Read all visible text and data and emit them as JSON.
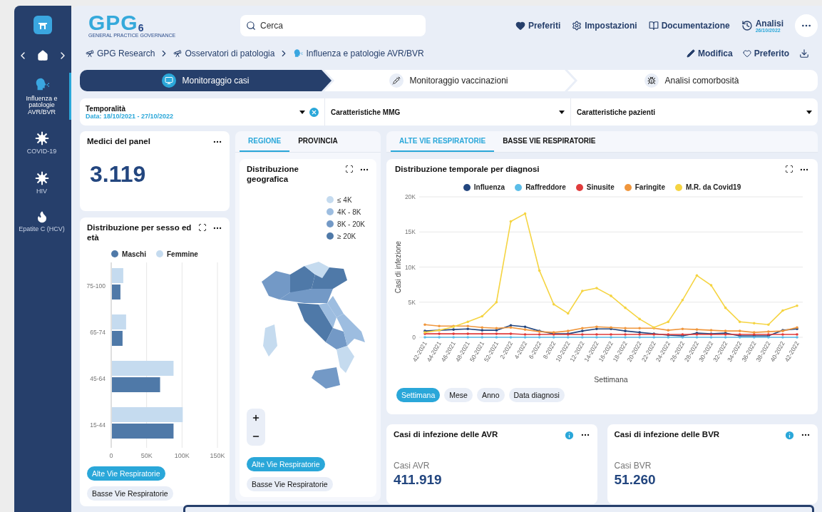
{
  "logo": {
    "text": "GPG",
    "subtitle": "GENERAL PRACTICE GOVERNANCE",
    "badge": "6"
  },
  "sidebar": {
    "items": [
      {
        "label": "Influenza e patologie AVR/BVR",
        "kind": "head",
        "selected": true
      },
      {
        "label": "COVID-19",
        "kind": "virus",
        "selected": false
      },
      {
        "label": "HIV",
        "kind": "virus",
        "selected": false
      },
      {
        "label": "Epatite C (HCV)",
        "kind": "flame",
        "selected": false
      }
    ]
  },
  "header": {
    "search": {
      "placeholder": "Cerca"
    },
    "links": [
      {
        "label": "Preferiti",
        "kind": "heart"
      },
      {
        "label": "Impostazioni",
        "kind": "gear"
      },
      {
        "label": "Documentazione",
        "kind": "book"
      }
    ],
    "analysis": {
      "label": "Analisi",
      "date": "26/10/2022"
    }
  },
  "breadcrumb": [
    {
      "label": "GPG Research",
      "kind": "telescope"
    },
    {
      "label": "Osservatori di patologia",
      "kind": "telescope"
    },
    {
      "label": "Influenza e patologie AVR/BVR",
      "kind": "head"
    }
  ],
  "actions": [
    {
      "label": "Modifica",
      "kind": "pencil"
    },
    {
      "label": "Preferito",
      "kind": "heart"
    },
    {
      "kind": "download"
    }
  ],
  "steps": [
    {
      "label": "Monitoraggio casi",
      "kind": "monitor",
      "selected": true
    },
    {
      "label": "Monitoraggio vaccinazioni",
      "kind": "syringe",
      "selected": false
    },
    {
      "label": "Analisi comorbosità",
      "kind": "bug",
      "selected": false
    }
  ],
  "filters": [
    {
      "label": "Temporalità",
      "value": "Data: 18/10/2021 - 27/10/2022",
      "clearable": true
    },
    {
      "label": "Caratteristiche MMG",
      "clearable": false
    },
    {
      "label": "Caratteristiche pazienti",
      "clearable": false
    }
  ],
  "panel_card": {
    "title": "Medici del panel",
    "value": "3.119"
  },
  "age_sex": {
    "title": "Distribuzione per sesso ed età",
    "chart_data": {
      "type": "bar",
      "orientation": "horizontal",
      "categories": [
        "75-100",
        "65-74",
        "45-64",
        "15-44"
      ],
      "series": [
        {
          "name": "Maschi",
          "color": "#4f79a8",
          "values": [
            12000,
            15000,
            68000,
            87000
          ]
        },
        {
          "name": "Femmine",
          "color": "#c5dbef",
          "values": [
            16000,
            20000,
            87000,
            100000
          ]
        }
      ],
      "xlim": [
        0,
        150000
      ],
      "grid": true,
      "xticks": [
        {
          "value": 0,
          "label": "0"
        },
        {
          "value": 50000,
          "label": "50K"
        },
        {
          "value": 100000,
          "label": "100K"
        },
        {
          "value": 150000,
          "label": "150K"
        }
      ]
    },
    "filters": [
      {
        "label": "Alte Vie Respiratorie",
        "selected": true
      },
      {
        "label": "Basse Vie Respiratorie",
        "selected": false
      }
    ]
  },
  "geo": {
    "tabs": [
      {
        "label": "REGIONE",
        "selected": true
      },
      {
        "label": "PROVINCIA",
        "selected": false
      }
    ],
    "title": "Distribuzione geografica",
    "legend": [
      {
        "label": "≤ 4K",
        "color": "#c5dbef"
      },
      {
        "label": "4K - 8K",
        "color": "#9dbde0"
      },
      {
        "label": "8K - 20K",
        "color": "#7399c6"
      },
      {
        "label": "≥ 20K",
        "color": "#4f79a8"
      }
    ],
    "filters": [
      {
        "label": "Alte Vie Respiratorie",
        "selected": true
      },
      {
        "label": "Basse Vie Respiratorie",
        "selected": false
      }
    ]
  },
  "diagnosis": {
    "tabs": [
      {
        "label": "ALTE VIE RESPIRATORIE",
        "selected": true
      },
      {
        "label": "BASSE VIE RESPIRATORIE",
        "selected": false
      }
    ],
    "title": "Distribuzione temporale per diagnosi",
    "chart_data": {
      "type": "line",
      "xlabel": "Settimana",
      "ylabel": "Casi di infezione",
      "categories": [
        "42-2021",
        "44-2021",
        "46-2021",
        "48-2021",
        "50-2021",
        "52-2021",
        "2-2022",
        "4-2022",
        "6-2022",
        "8-2022",
        "10-2022",
        "12-2022",
        "14-2022",
        "16-2022",
        "18-2022",
        "20-2022",
        "22-2022",
        "24-2022",
        "26-2022",
        "28-2022",
        "30-2022",
        "32-2022",
        "34-2022",
        "36-2022",
        "38-2022",
        "40-2022",
        "42-2022"
      ],
      "series": [
        {
          "name": "Influenza",
          "color": "#23467f",
          "values": [
            900,
            1000,
            1100,
            1200,
            1000,
            1000,
            1700,
            1500,
            900,
            500,
            500,
            900,
            1200,
            1200,
            900,
            700,
            500,
            300,
            200,
            600,
            500,
            600,
            200,
            200,
            200,
            1000,
            1200
          ]
        },
        {
          "name": "Raffreddore",
          "color": "#5bbde8",
          "values": [
            0,
            0,
            0,
            0,
            0,
            0,
            0,
            0,
            0,
            0,
            0,
            0,
            0,
            0,
            0,
            0,
            0,
            0,
            0,
            0,
            0,
            0,
            0,
            0,
            0,
            0,
            0
          ]
        },
        {
          "name": "Sinusite",
          "color": "#e03c3c",
          "values": [
            500,
            500,
            500,
            500,
            500,
            500,
            500,
            400,
            400,
            400,
            400,
            400,
            400,
            400,
            400,
            400,
            400,
            400,
            400,
            400,
            400,
            400,
            400,
            400,
            400,
            400,
            400
          ]
        },
        {
          "name": "Faringite",
          "color": "#f0963c",
          "values": [
            1800,
            1600,
            1600,
            1600,
            1400,
            1300,
            1400,
            1100,
            800,
            700,
            900,
            1300,
            1500,
            1400,
            1300,
            1300,
            1300,
            1000,
            1200,
            1100,
            1000,
            900,
            900,
            700,
            800,
            900,
            1400
          ]
        },
        {
          "name": "M.R. da Covid19",
          "color": "#f5d442",
          "values": [
            700,
            1000,
            1500,
            2200,
            3000,
            5000,
            16500,
            17600,
            9500,
            4700,
            3400,
            6600,
            7000,
            5900,
            4200,
            2600,
            1400,
            2200,
            5300,
            8800,
            7400,
            4200,
            2200,
            2000,
            1800,
            3800,
            4500
          ]
        }
      ],
      "ylim": [
        0,
        20000
      ],
      "grid": true,
      "yticks": [
        {
          "value": 0,
          "label": "0"
        },
        {
          "value": 5000,
          "label": "5K"
        },
        {
          "value": 10000,
          "label": "10K"
        },
        {
          "value": 15000,
          "label": "15K"
        },
        {
          "value": 20000,
          "label": "20K"
        }
      ]
    },
    "periods": [
      {
        "label": "Settimana",
        "selected": true
      },
      {
        "label": "Mese",
        "selected": false
      },
      {
        "label": "Anno",
        "selected": false
      },
      {
        "label": "Data diagnosi",
        "selected": false
      }
    ]
  },
  "kpis": [
    {
      "title": "Casi di infezione delle AVR",
      "label": "Casi AVR",
      "value": "411.919"
    },
    {
      "title": "Casi di infezione delle BVR",
      "label": "Casi BVR",
      "value": "51.260"
    }
  ]
}
